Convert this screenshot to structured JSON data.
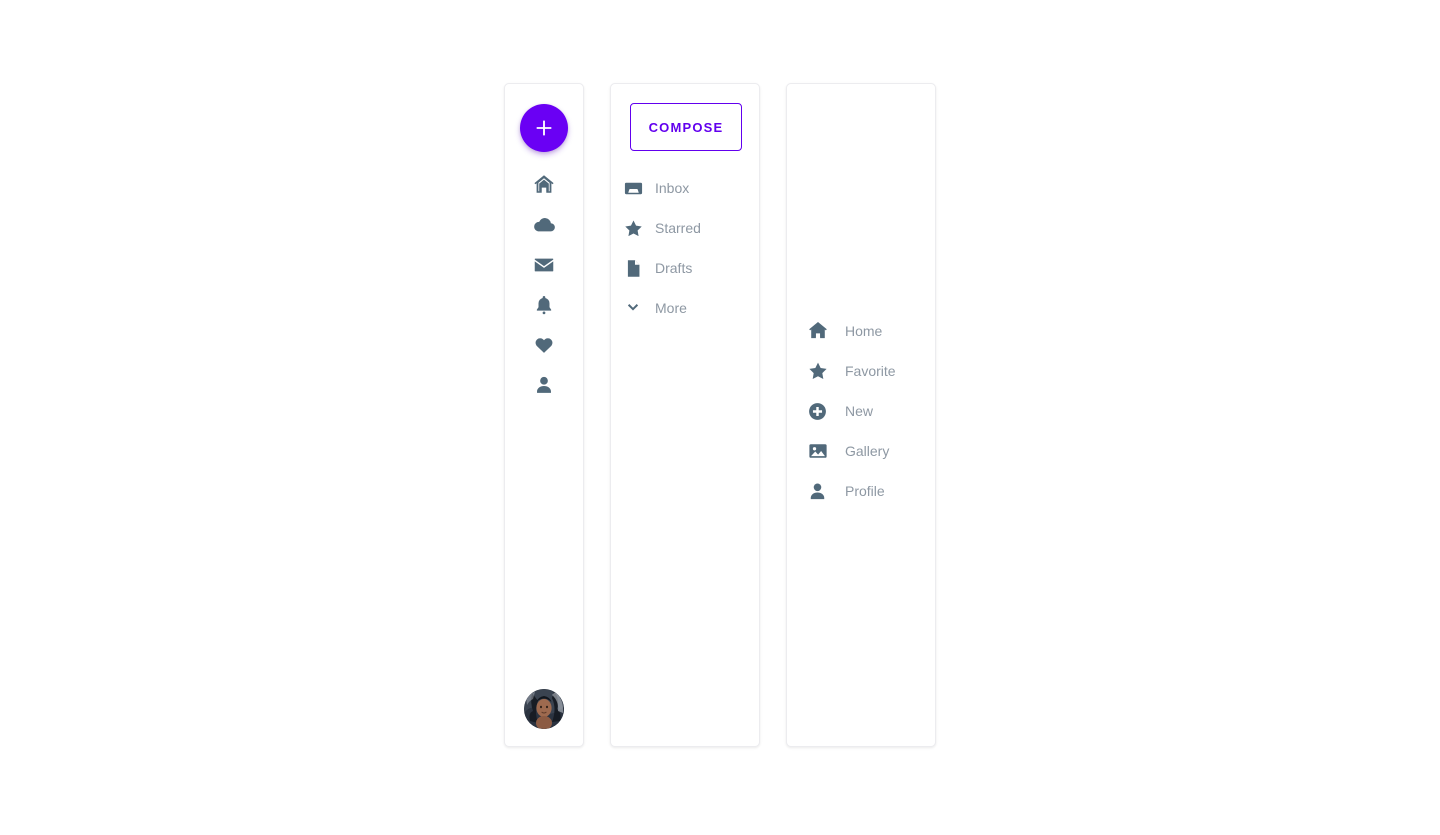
{
  "theme": {
    "accent_purple": "#6a00f4",
    "compose_purple": "#6200ee",
    "icon_slate": "#51697a",
    "label_gray": "#8e98a3",
    "panel_border": "#ececef",
    "page_background": "#ffffff"
  },
  "rail": {
    "fab": {
      "label": "+",
      "icon": "plus-icon",
      "name": "create-fab"
    },
    "items": [
      {
        "icon": "home-icon",
        "name": "rail-item-home"
      },
      {
        "icon": "cloud-icon",
        "name": "rail-item-cloud"
      },
      {
        "icon": "envelope-icon",
        "name": "rail-item-mail"
      },
      {
        "icon": "bell-icon",
        "name": "rail-item-notifications"
      },
      {
        "icon": "heart-icon",
        "name": "rail-item-favorites"
      },
      {
        "icon": "person-icon",
        "name": "rail-item-account"
      }
    ],
    "avatar": {
      "icon": "user-avatar",
      "name": "avatar"
    }
  },
  "mail": {
    "compose_label": "COMPOSE",
    "items": [
      {
        "label": "Inbox",
        "icon": "inbox-icon"
      },
      {
        "label": "Starred",
        "icon": "star-icon"
      },
      {
        "label": "Drafts",
        "icon": "document-icon"
      },
      {
        "label": "More",
        "icon": "chevron-down-icon"
      }
    ]
  },
  "menu": {
    "items": [
      {
        "label": "Home",
        "icon": "home-icon"
      },
      {
        "label": "Favorite",
        "icon": "star-icon"
      },
      {
        "label": "New",
        "icon": "plus-circle-icon"
      },
      {
        "label": "Gallery",
        "icon": "image-icon"
      },
      {
        "label": "Profile",
        "icon": "person-icon"
      }
    ]
  }
}
